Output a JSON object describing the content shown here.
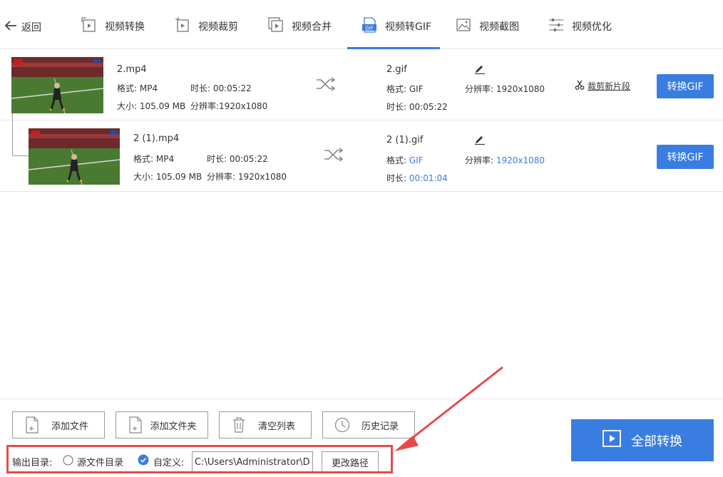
{
  "nav": {
    "back_label": "返回",
    "tabs": [
      {
        "label": "视频转换",
        "icon": "video-convert-icon"
      },
      {
        "label": "视频裁剪",
        "icon": "video-crop-icon"
      },
      {
        "label": "视频合并",
        "icon": "video-merge-icon"
      },
      {
        "label": "视频转GIF",
        "icon": "gif-icon",
        "active": true
      },
      {
        "label": "视频截图",
        "icon": "image-icon"
      },
      {
        "label": "视频优化",
        "icon": "sliders-icon"
      }
    ],
    "gif_badge": "GIF"
  },
  "files": [
    {
      "input_name": "2.mp4",
      "format_label": "格式: MP4",
      "duration_label": "时长: 00:05:22",
      "size_label": "大小: 105.09 MB",
      "resolution_label": "分辨率:1920x1080",
      "output_name": "2.gif",
      "out_format_label": "格式:",
      "out_format_value": "GIF",
      "out_resolution_label": "分辨率:",
      "out_resolution_value": "1920x1080",
      "out_duration_label": "时长:",
      "out_duration_value": "00:05:22",
      "cut_label": "裁剪新片段",
      "convert_label": "转换GIF"
    },
    {
      "input_name": "2 (1).mp4",
      "format_label": "格式: MP4",
      "duration_label": "时长: 00:05:22",
      "size_label": "大小: 105.09 MB",
      "resolution_label": "分辨率: 1920x1080",
      "output_name": "2 (1).gif",
      "out_format_label": "格式:",
      "out_format_value": "GIF",
      "out_resolution_label": "分辨率:",
      "out_resolution_value": "1920x1080",
      "out_duration_label": "时长:",
      "out_duration_value": "00:01:04",
      "convert_label": "转换GIF"
    }
  ],
  "toolbar": {
    "add_file": "添加文件",
    "add_folder": "添加文件夹",
    "clear_list": "清空列表",
    "history": "历史记录",
    "convert_all": "全部转换"
  },
  "output": {
    "label": "输出目录:",
    "option_source": "源文件目录",
    "option_custom": "自定义:",
    "path_value": "C:\\Users\\Administrator\\D",
    "change_path": "更改路径"
  },
  "colors": {
    "accent": "#3a7de0",
    "annotation": "#e84a4a"
  }
}
